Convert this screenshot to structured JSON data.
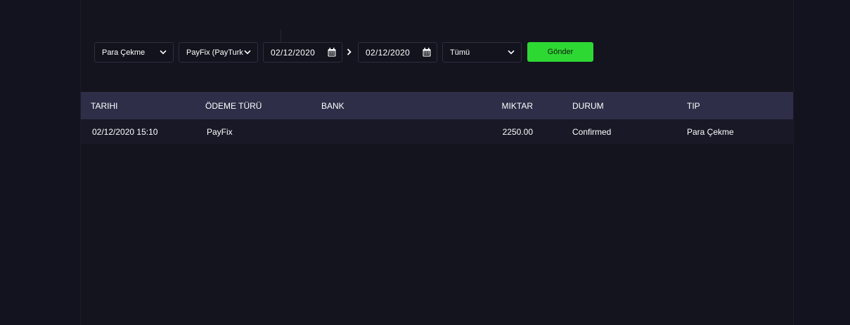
{
  "filters": {
    "type_select": "Para Çekme",
    "method_select": "PayFix (PayTurka)",
    "date_from": "02/12/2020",
    "date_to": "02/12/2020",
    "status_select": "Tümü",
    "submit_label": "Gönder"
  },
  "table": {
    "headers": {
      "date": "TARIHI",
      "payment_type": "ÖDEME TÜRÜ",
      "bank": "BANK",
      "amount": "MIKTAR",
      "status": "DURUM",
      "type": "TIP"
    },
    "rows": [
      {
        "date": "02/12/2020 15:10",
        "payment_type": "PayFix",
        "bank": "",
        "amount": "2250.00",
        "status": "Confirmed",
        "type": "Para Çekme"
      }
    ]
  },
  "colors": {
    "background": "#13131f",
    "table_header": "#2e2e48",
    "table_row": "#181826",
    "accent_green": "#2ed833"
  },
  "icons": {
    "dropdown": "chevron-down-icon",
    "date": "calendar-icon",
    "range": "chevron-right-icon"
  }
}
